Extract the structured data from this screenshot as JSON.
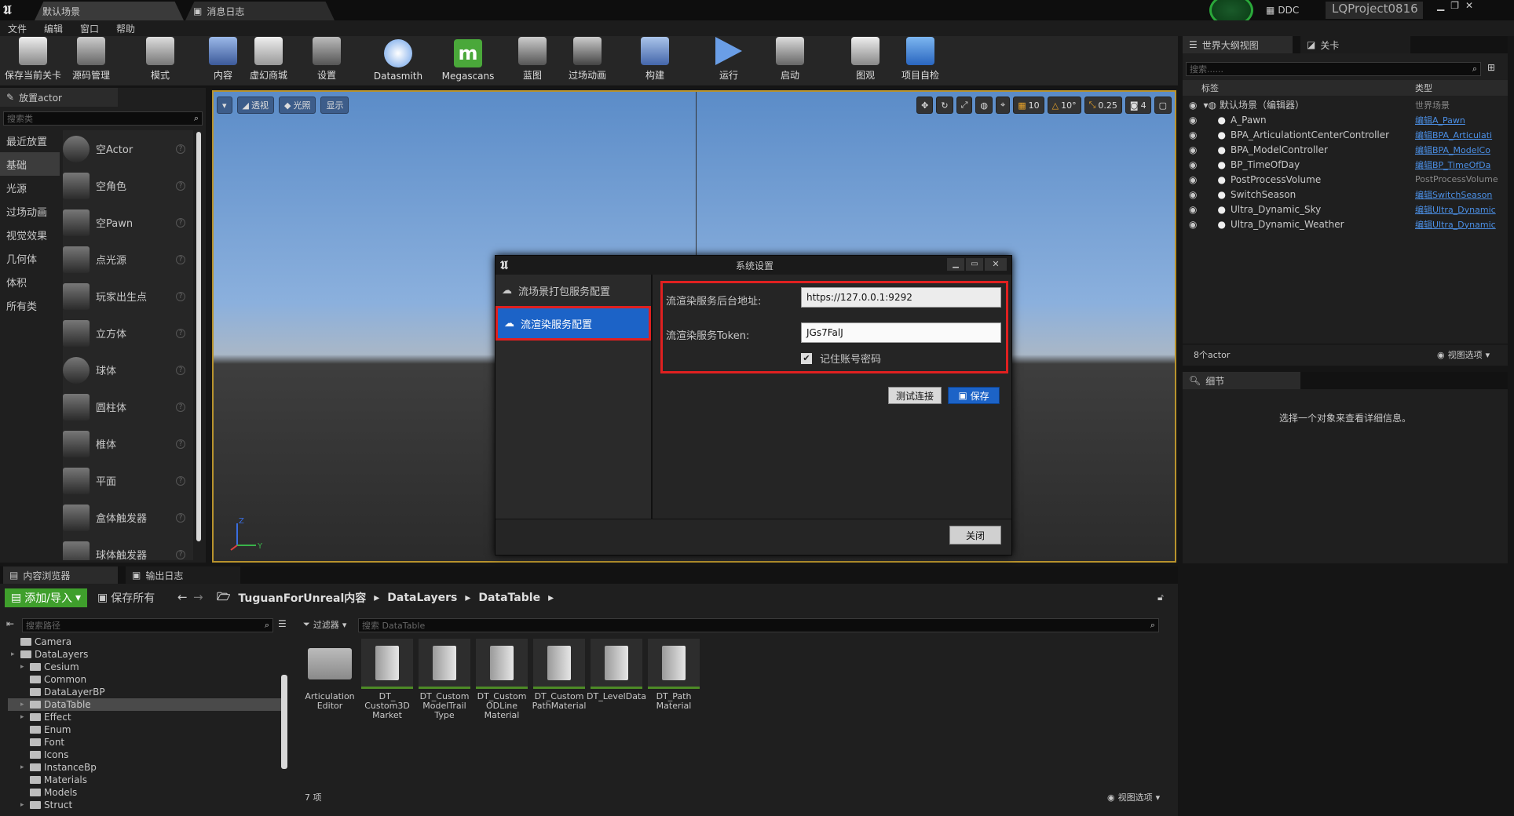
{
  "titlebar": {
    "tab1": "默认场景",
    "tab2": "消息日志",
    "ddc": "DDC",
    "project": "LQProject0816"
  },
  "menu": [
    "文件",
    "编辑",
    "窗口",
    "帮助"
  ],
  "toolbar": {
    "save": "保存当前关卡",
    "source": "源码管理",
    "modes": "模式",
    "content": "内容",
    "marketplace": "虚幻商城",
    "settings": "设置",
    "datasmith": "Datasmith",
    "megascans": "Megascans",
    "blueprint": "蓝图",
    "cinematics": "过场动画",
    "build": "构建",
    "play": "运行",
    "launch": "启动",
    "chart": "图观",
    "project_check": "项目自检"
  },
  "place_actor": {
    "title": "放置actor",
    "search": "搜索类",
    "categories": [
      "最近放置",
      "基础",
      "光源",
      "过场动画",
      "视觉效果",
      "几何体",
      "体积",
      "所有类"
    ],
    "items": [
      "空Actor",
      "空角色",
      "空Pawn",
      "点光源",
      "玩家出生点",
      "立方体",
      "球体",
      "圆柱体",
      "椎体",
      "平面",
      "盒体触发器",
      "球体触发器"
    ]
  },
  "viewport": {
    "perspective": "透视",
    "lit": "光照",
    "show": "显示",
    "grid": "10",
    "angle": "10°",
    "scale": "0.25",
    "camera_speed": "4"
  },
  "dialog": {
    "title": "系统设置",
    "nav": [
      "流场景打包服务配置",
      "流渲染服务配置"
    ],
    "address_label": "流渲染服务后台地址:",
    "address_value": "https://127.0.0.1:9292",
    "token_label": "流渲染服务Token:",
    "token_value": "JGs7FalJ",
    "remember": "记住账号密码",
    "test_btn": "测试连接",
    "save_btn": "保存",
    "close_btn": "关闭"
  },
  "outliner": {
    "tab1": "世界大纲视图",
    "tab2": "关卡",
    "search": "搜索......",
    "col_label": "标签",
    "col_type": "类型",
    "root": {
      "name": "默认场景（编辑器）",
      "type": "世界场景"
    },
    "rows": [
      {
        "name": "A_Pawn",
        "type": "编辑A_Pawn",
        "link": true
      },
      {
        "name": "BPA_ArticulationtCenterController",
        "type": "编辑BPA_Articulati",
        "link": true
      },
      {
        "name": "BPA_ModelController",
        "type": "编辑BPA_ModelCo",
        "link": true
      },
      {
        "name": "BP_TimeOfDay",
        "type": "编辑BP_TimeOfDa",
        "link": true
      },
      {
        "name": "PostProcessVolume",
        "type": "PostProcessVolume",
        "link": false
      },
      {
        "name": "SwitchSeason",
        "type": "编辑SwitchSeason",
        "link": true
      },
      {
        "name": "Ultra_Dynamic_Sky",
        "type": "编辑Ultra_Dynamic",
        "link": true
      },
      {
        "name": "Ultra_Dynamic_Weather",
        "type": "编辑Ultra_Dynamic",
        "link": true
      }
    ],
    "count": "8个actor",
    "view_options": "视图选项"
  },
  "details": {
    "tab": "细节",
    "empty": "选择一个对象来查看详细信息。"
  },
  "content_browser": {
    "tab1": "内容浏览器",
    "tab2": "输出日志",
    "add": "添加/导入",
    "save_all": "保存所有",
    "path": [
      "TuguanForUnreal内容",
      "DataLayers",
      "DataTable"
    ],
    "search_path": "搜索路径",
    "filter": "过滤器",
    "search_asset": "搜索 DataTable",
    "tree": [
      "Camera",
      "DataLayers",
      "Cesium",
      "Common",
      "DataLayerBP",
      "DataTable",
      "Effect",
      "Enum",
      "Font",
      "Icons",
      "InstanceBp",
      "Materials",
      "Models",
      "Struct"
    ],
    "assets": [
      {
        "name": "Articulation Editor",
        "type": "folder"
      },
      {
        "name": "DT_ Custom3D Market",
        "type": "table"
      },
      {
        "name": "DT_Custom ModelTrail Type",
        "type": "table"
      },
      {
        "name": "DT_Custom ODLine Material",
        "type": "table"
      },
      {
        "name": "DT_Custom PathMaterial",
        "type": "table"
      },
      {
        "name": "DT_LevelData",
        "type": "table"
      },
      {
        "name": "DT_Path Material",
        "type": "table"
      }
    ],
    "count": "7 项",
    "view_options": "视图选项"
  },
  "colors": {
    "accent_blue": "#1c63c7",
    "highlight_red": "#e02020",
    "add_green": "#3f9f2c",
    "viewport_border": "#b8932d"
  }
}
